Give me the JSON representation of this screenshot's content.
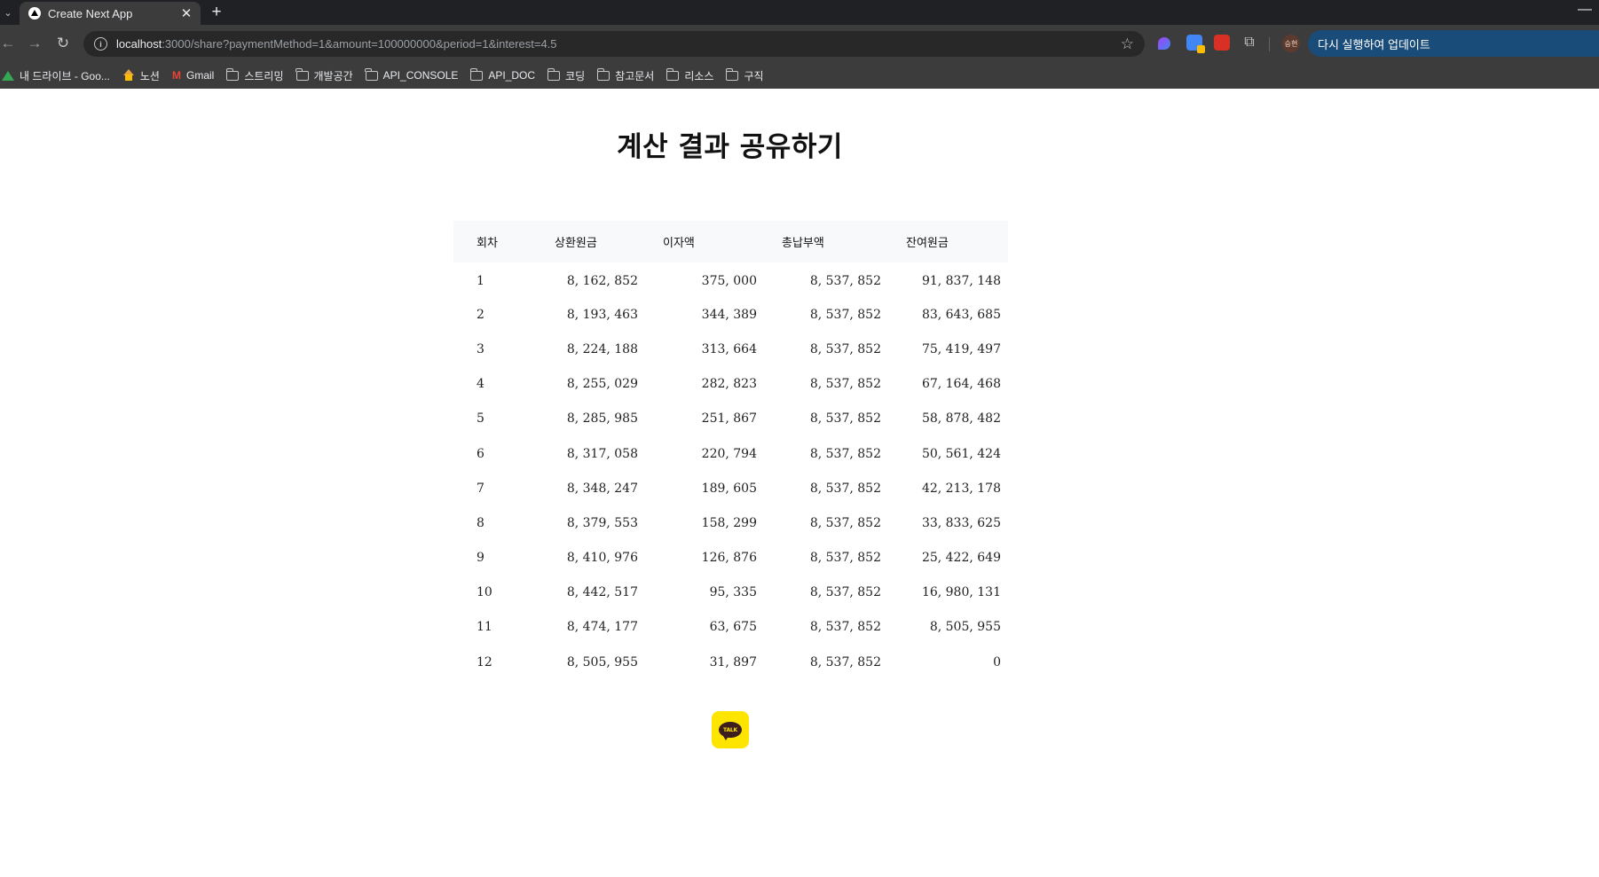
{
  "browser": {
    "tab_title": "Create Next App",
    "new_tab_label": "+",
    "close_label": "✕",
    "url_host": "localhost",
    "url_path": ":3000/share?paymentMethod=1&amount=100000000&period=1&interest=4.5",
    "avatar_label": "승현",
    "relaunch_label": "다시 실행하여 업데이트"
  },
  "bookmarks": [
    {
      "label": "내 드라이브 - Goo...",
      "icon": "drive-icon"
    },
    {
      "label": "노션",
      "icon": "notion-icon"
    },
    {
      "label": "Gmail",
      "icon": "gmail-icon"
    },
    {
      "label": "스트리밍",
      "icon": "folder-icon"
    },
    {
      "label": "개발공간",
      "icon": "folder-icon"
    },
    {
      "label": "API_CONSOLE",
      "icon": "folder-icon"
    },
    {
      "label": "API_DOC",
      "icon": "folder-icon"
    },
    {
      "label": "코딩",
      "icon": "folder-icon"
    },
    {
      "label": "참고문서",
      "icon": "folder-icon"
    },
    {
      "label": "리소스",
      "icon": "folder-icon"
    },
    {
      "label": "구직",
      "icon": "folder-icon"
    }
  ],
  "page": {
    "title": "계산 결과 공유하기",
    "kakao_label": "TALK"
  },
  "table": {
    "headers": [
      "회차",
      "상환원금",
      "이자액",
      "총납부액",
      "잔여원금"
    ],
    "rows": [
      [
        "1",
        "8, 162, 852",
        "375, 000",
        "8, 537, 852",
        "91, 837, 148"
      ],
      [
        "2",
        "8, 193, 463",
        "344, 389",
        "8, 537, 852",
        "83, 643, 685"
      ],
      [
        "3",
        "8, 224, 188",
        "313, 664",
        "8, 537, 852",
        "75, 419, 497"
      ],
      [
        "4",
        "8, 255, 029",
        "282, 823",
        "8, 537, 852",
        "67, 164, 468"
      ],
      [
        "5",
        "8, 285, 985",
        "251, 867",
        "8, 537, 852",
        "58, 878, 482"
      ],
      [
        "6",
        "8, 317, 058",
        "220, 794",
        "8, 537, 852",
        "50, 561, 424"
      ],
      [
        "7",
        "8, 348, 247",
        "189, 605",
        "8, 537, 852",
        "42, 213, 178"
      ],
      [
        "8",
        "8, 379, 553",
        "158, 299",
        "8, 537, 852",
        "33, 833, 625"
      ],
      [
        "9",
        "8, 410, 976",
        "126, 876",
        "8, 537, 852",
        "25, 422, 649"
      ],
      [
        "10",
        "8, 442, 517",
        "95, 335",
        "8, 537, 852",
        "16, 980, 131"
      ],
      [
        "11",
        "8, 474, 177",
        "63, 675",
        "8, 537, 852",
        "8, 505, 955"
      ],
      [
        "12",
        "8, 505, 955",
        "31, 897",
        "8, 537, 852",
        "0"
      ]
    ]
  }
}
